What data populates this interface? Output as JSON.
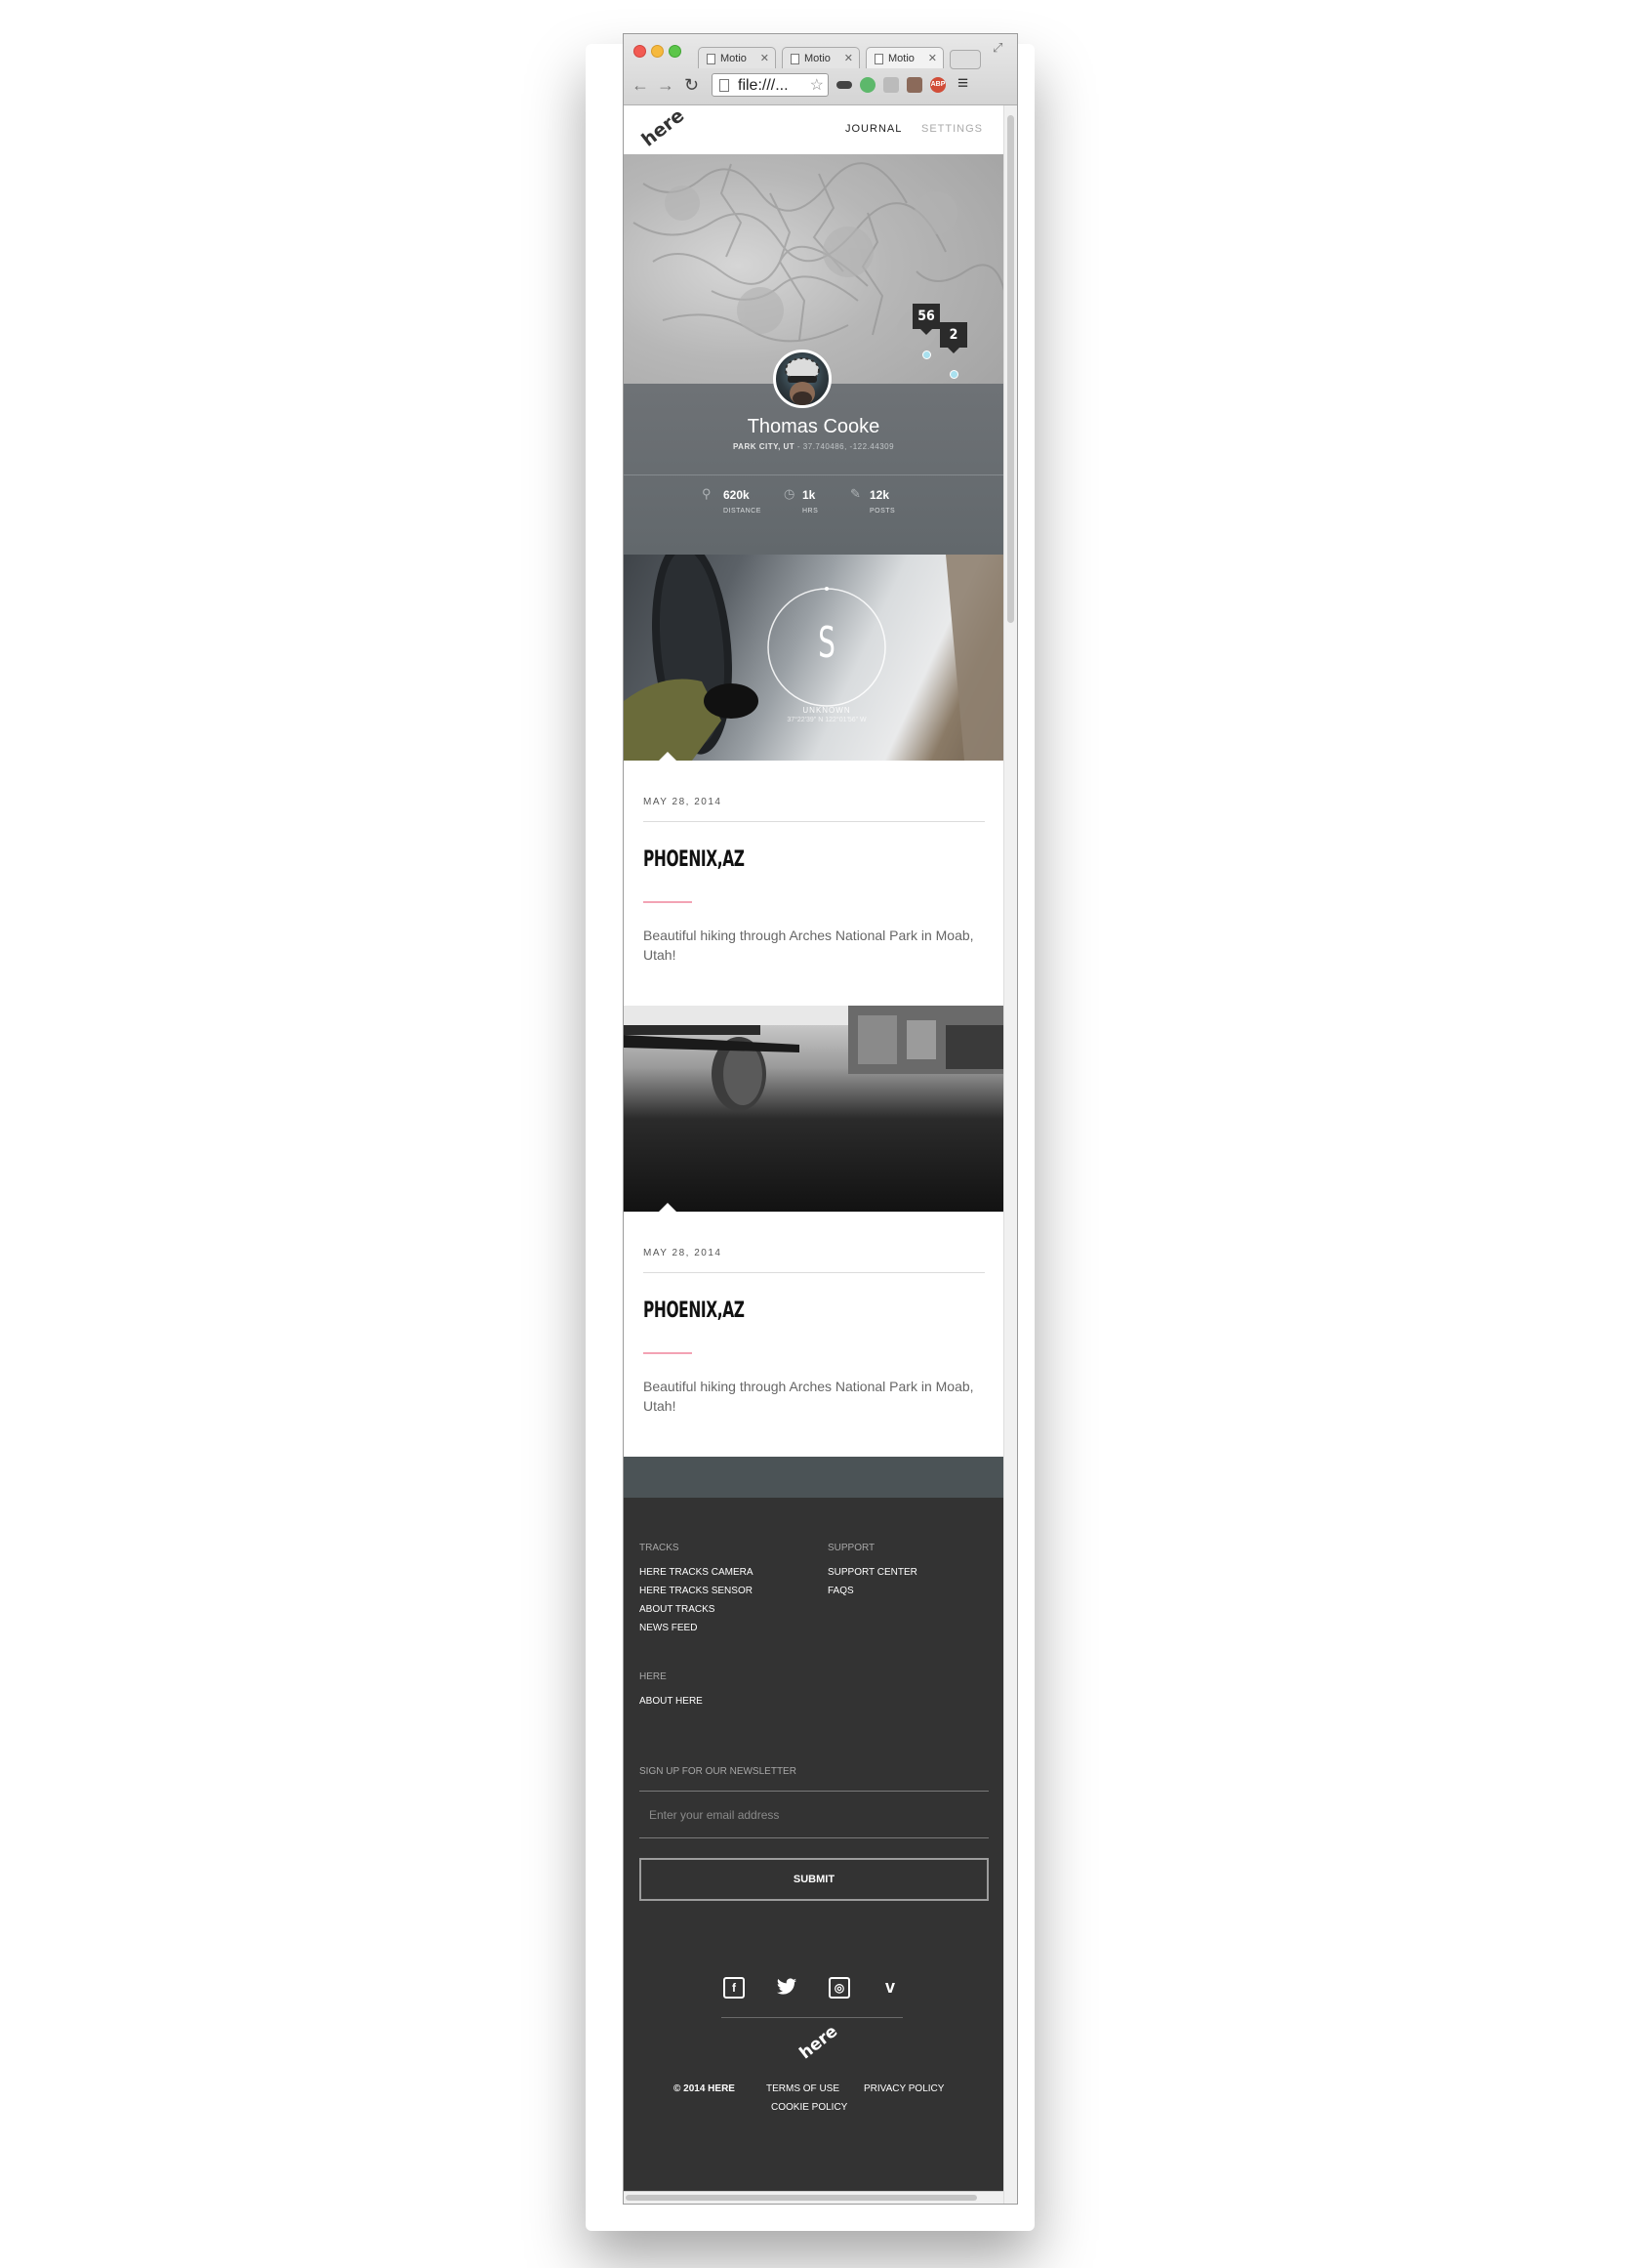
{
  "browser": {
    "tabs": [
      {
        "label": "Motio"
      },
      {
        "label": "Motio"
      },
      {
        "label": "Motio"
      }
    ],
    "url": "file:///..."
  },
  "nav": {
    "logo": "here",
    "journal": "JOURNAL",
    "settings": "SETTINGS"
  },
  "map": {
    "clusters": [
      {
        "count": "56"
      },
      {
        "count": "2"
      }
    ]
  },
  "profile": {
    "name": "Thomas Cooke",
    "location": "PARK CITY, UT",
    "coords": " - 37.740486, -122.44309",
    "stats": [
      {
        "value": "620k",
        "label": "DISTANCE",
        "icon": "map-pin-icon"
      },
      {
        "value": "1k",
        "label": "HRS",
        "icon": "stopwatch-icon"
      },
      {
        "value": "12k",
        "label": "POSTS",
        "icon": "pencil-icon"
      }
    ]
  },
  "posts": [
    {
      "compass_letter": "S",
      "compass_place": "UNKNOWN",
      "compass_coords": "37°22'39\" N 122°01'56\" W",
      "date": "MAY 28, 2014",
      "title": "PHOENIX,AZ",
      "description": "Beautiful hiking through Arches National Park in Moab, Utah!"
    },
    {
      "date": "MAY 28, 2014",
      "title": "PHOENIX,AZ",
      "description": "Beautiful hiking through Arches National Park in Moab, Utah!"
    }
  ],
  "footer": {
    "tracks_heading": "TRACKS",
    "tracks_links": [
      "HERE TRACKS CAMERA",
      "HERE TRACKS SENSOR",
      "ABOUT TRACKS",
      "NEWS FEED"
    ],
    "support_heading": "SUPPORT",
    "support_links": [
      "SUPPORT CENTER",
      "FAQS"
    ],
    "here_heading": "HERE",
    "here_links": [
      "ABOUT HERE"
    ],
    "newsletter_heading": "SIGN UP FOR OUR NEWSLETTER",
    "email_placeholder": "Enter your email address",
    "submit": "SUBMIT",
    "social": [
      "facebook-icon",
      "twitter-icon",
      "instagram-icon",
      "vimeo-icon"
    ],
    "logo": "here",
    "copyright": "© 2014 HERE",
    "terms": "TERMS OF USE",
    "privacy": "PRIVACY POLICY",
    "cookie": "COOKIE POLICY"
  },
  "colors": {
    "accent_pink": "#f3a3b4",
    "map_pin": "#a9e0ee",
    "footer_bg": "#333333",
    "profile_band": "#666c70"
  }
}
